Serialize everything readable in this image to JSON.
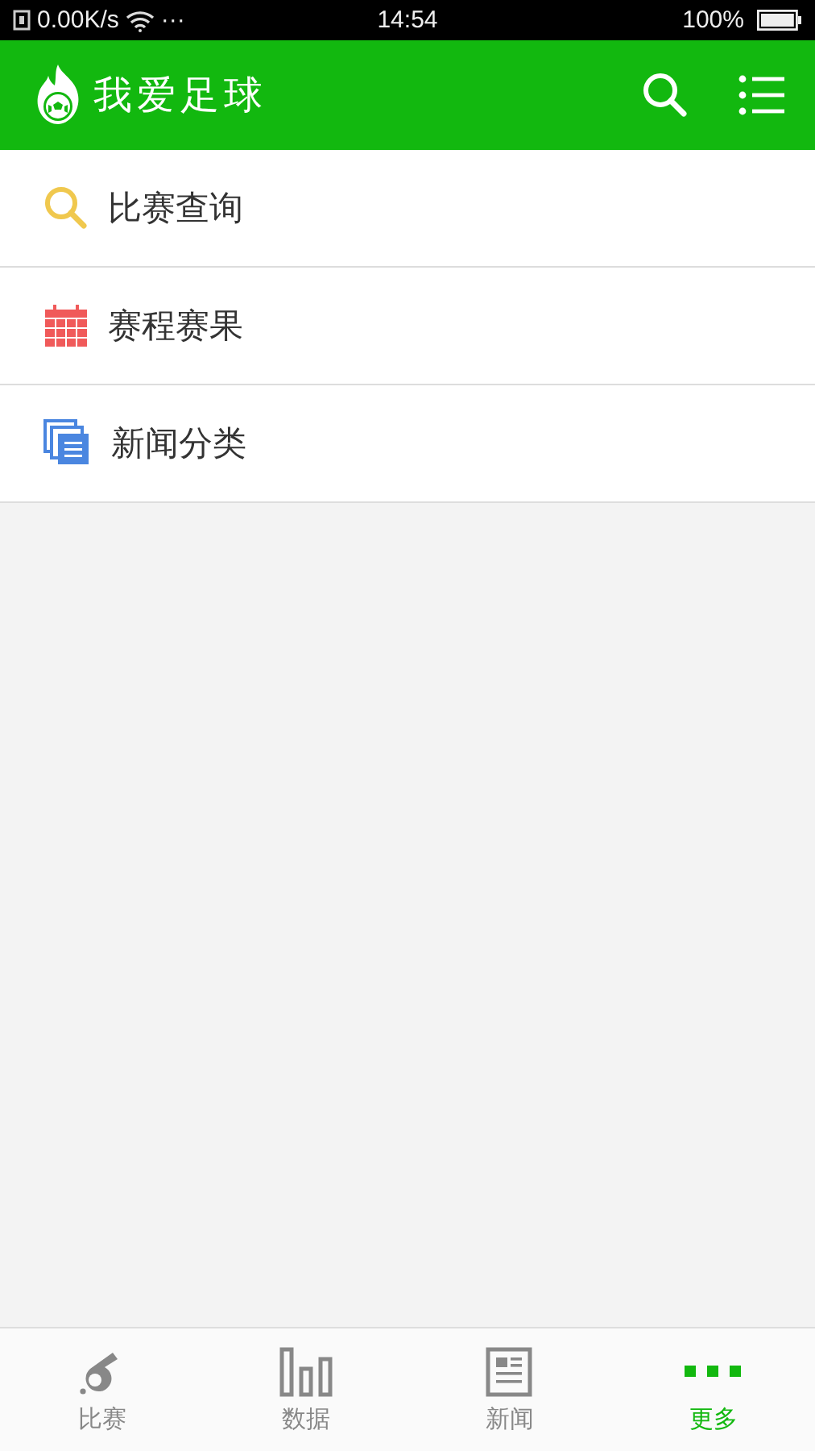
{
  "status_bar": {
    "speed": "0.00K/s",
    "dots": "···",
    "time": "14:54",
    "battery": "100%"
  },
  "header": {
    "title": "我爱足球"
  },
  "menu": [
    {
      "kind": "search",
      "label": "比赛查询"
    },
    {
      "kind": "calendar",
      "label": "赛程赛果"
    },
    {
      "kind": "documents",
      "label": "新闻分类"
    }
  ],
  "tabs": [
    {
      "kind": "whistle",
      "label": "比赛",
      "selected": false
    },
    {
      "kind": "bars",
      "label": "数据",
      "selected": false
    },
    {
      "kind": "news",
      "label": "新闻",
      "selected": false
    },
    {
      "kind": "more",
      "label": "更多",
      "selected": true
    }
  ]
}
